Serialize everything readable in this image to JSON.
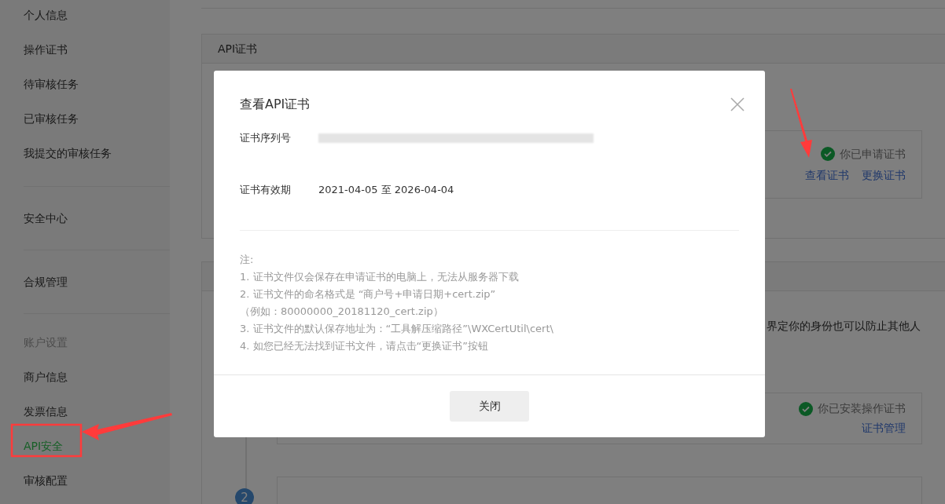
{
  "sidebar": {
    "sections": [
      {
        "items": [
          {
            "label": "个人信息",
            "selected": false
          },
          {
            "label": "操作证书",
            "selected": false
          },
          {
            "label": "待审核任务",
            "selected": false
          },
          {
            "label": "已审核任务",
            "selected": false
          },
          {
            "label": "我提交的审核任务",
            "selected": false
          }
        ]
      },
      {
        "items": [
          {
            "label": "安全中心",
            "selected": false
          }
        ]
      },
      {
        "items": [
          {
            "label": "合规管理",
            "selected": false
          }
        ]
      },
      {
        "heading": "账户设置",
        "items": [
          {
            "label": "商户信息",
            "selected": false
          },
          {
            "label": "发票信息",
            "selected": false
          },
          {
            "label": "API安全",
            "selected": true
          },
          {
            "label": "审核配置",
            "selected": false
          }
        ]
      }
    ]
  },
  "api_cert_card": {
    "title": "API证书",
    "status": "你已申请证书",
    "links": [
      "查看证书",
      "更换证书"
    ]
  },
  "security_card": {
    "description_fragment": "界定你的身份也可以防止其他人",
    "status": "你已安装操作证书",
    "links": [
      "证书管理"
    ],
    "next_step": "2"
  },
  "modal": {
    "title": "查看API证书",
    "fields": [
      {
        "label": "证书序列号",
        "redacted": true
      },
      {
        "label": "证书有效期",
        "value": "2021-04-05 至 2026-04-04",
        "redacted": false
      }
    ],
    "notes": {
      "heading": "注:",
      "lines": [
        "1. 证书文件仅会保存在申请证书的电脑上，无法从服务器下载",
        "2. 证书文件的命名格式是 “商户号+申请日期+cert.zip”",
        "（例如：80000000_20181120_cert.zip）",
        "3. 证书文件的默认保存地址为：“工具解压缩路径”\\WXCertUtil\\cert\\",
        "4. 如您已经无法找到证书文件，请点击“更换证书”按钮"
      ]
    },
    "buttons": [
      "关闭"
    ]
  }
}
